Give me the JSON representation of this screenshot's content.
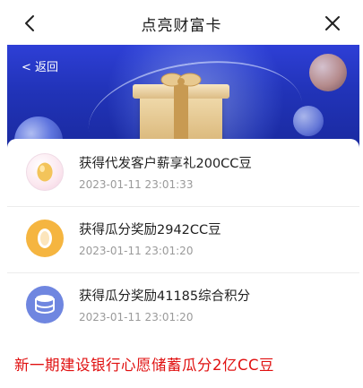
{
  "nav": {
    "title": "点亮财富卡",
    "back_icon": "chevron-left-icon",
    "close_icon": "close-icon"
  },
  "banner": {
    "back_label": "< 返回",
    "illustration": "gift-box-in-globe"
  },
  "records": [
    {
      "title": "获得代发客户薪享礼200CC豆",
      "time": "2023-01-11 23:01:33",
      "icon": "bean-badge-icon"
    },
    {
      "title": "获得瓜分奖励2942CC豆",
      "time": "2023-01-11 23:01:20",
      "icon": "bean-coin-icon"
    },
    {
      "title": "获得瓜分奖励41185综合积分",
      "time": "2023-01-11 23:01:20",
      "icon": "points-stack-icon"
    }
  ],
  "caption": "新一期建设银行心愿储蓄瓜分2亿CC豆",
  "colors": {
    "banner_blue": "#2133b8",
    "caption_red": "#e01010",
    "orange_icon": "#f5b540",
    "blue_icon": "#6f86e0"
  }
}
